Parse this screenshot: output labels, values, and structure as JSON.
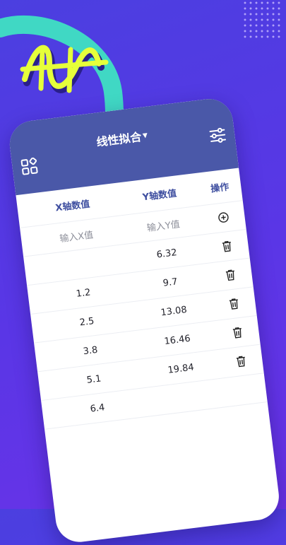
{
  "app": {
    "title": "线性拟合"
  },
  "icons": {
    "menu": "grid-menu-icon",
    "settings": "sliders-icon",
    "add": "plus-circle-icon",
    "delete": "trash-icon"
  },
  "colors": {
    "background": "#5a36e6",
    "header": "#4a58a8",
    "accent_teal": "#3fe0c2",
    "accent_yellow": "#e6ff3a"
  },
  "table": {
    "headers": {
      "x": "X轴数值",
      "y": "Y轴数值",
      "action": "操作"
    },
    "input": {
      "x_placeholder": "输入X值",
      "y_placeholder": "输入Y值"
    },
    "rows": [
      {
        "x": "",
        "y": "6.32"
      },
      {
        "x": "1.2",
        "y": "9.7"
      },
      {
        "x": "2.5",
        "y": "13.08"
      },
      {
        "x": "3.8",
        "y": "16.46"
      },
      {
        "x": "5.1",
        "y": "19.84"
      },
      {
        "x": "6.4",
        "y": ""
      }
    ]
  }
}
